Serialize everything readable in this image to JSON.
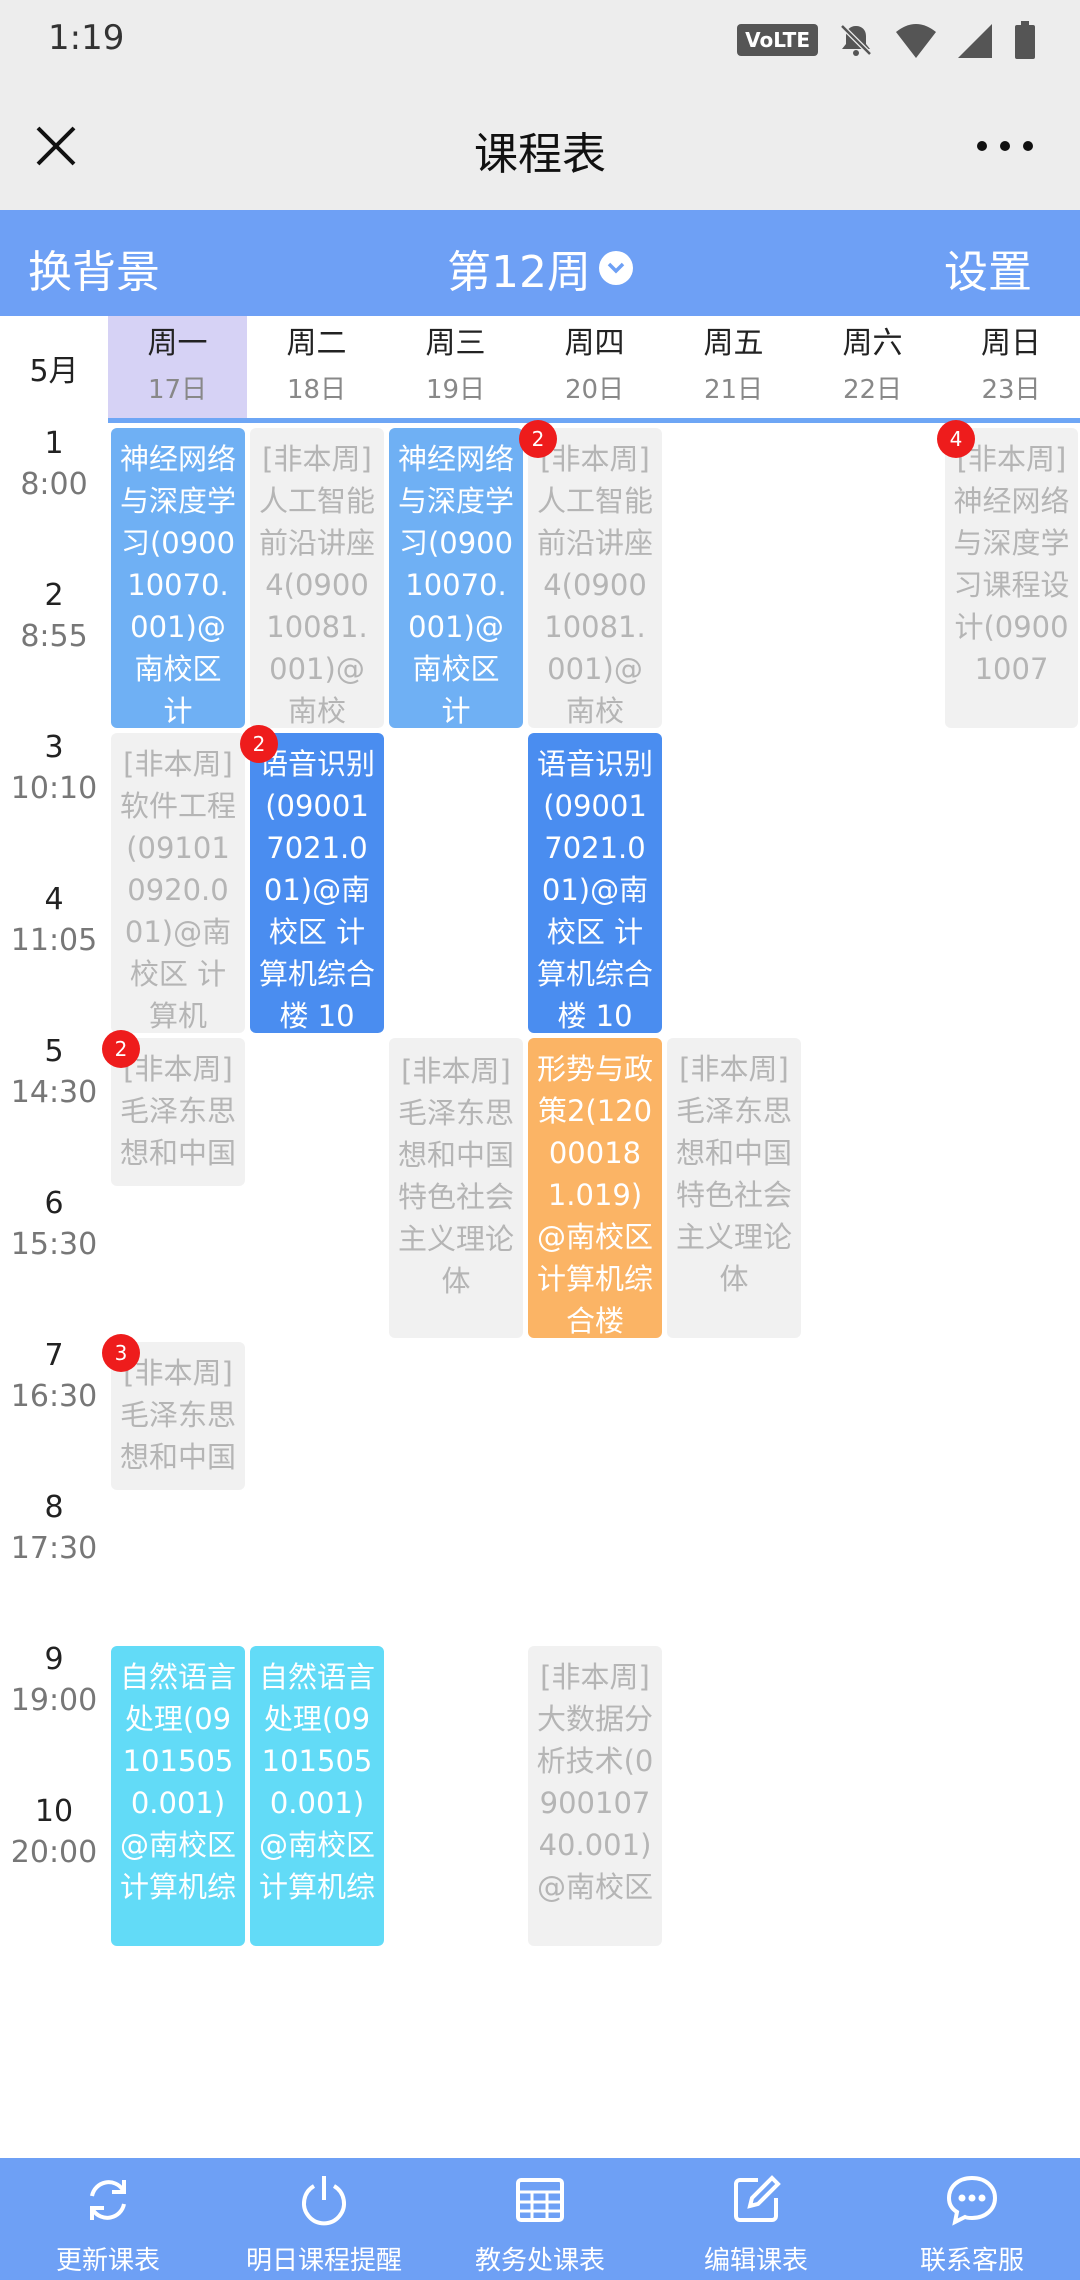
{
  "status_bar": {
    "time": "1:19",
    "network_badge": "VoLTE",
    "icons": [
      "mute-icon",
      "wifi-icon",
      "signal-icon",
      "battery-icon"
    ]
  },
  "title_bar": {
    "title": "课程表",
    "close_icon": "close-icon",
    "more_icon": "more-icon"
  },
  "toolbar": {
    "left_label": "换背景",
    "week_label": "第12周",
    "right_label": "设置",
    "accent": "#6ea0f5"
  },
  "header": {
    "month": "5月",
    "days": [
      {
        "weekday": "周一",
        "date": "17日",
        "active": true
      },
      {
        "weekday": "周二",
        "date": "18日"
      },
      {
        "weekday": "周三",
        "date": "19日"
      },
      {
        "weekday": "周四",
        "date": "20日"
      },
      {
        "weekday": "周五",
        "date": "21日"
      },
      {
        "weekday": "周六",
        "date": "22日"
      },
      {
        "weekday": "周日",
        "date": "23日"
      }
    ]
  },
  "periods": [
    {
      "num": "1",
      "time": "8:00"
    },
    {
      "num": "2",
      "time": "8:55"
    },
    {
      "num": "3",
      "time": "10:10"
    },
    {
      "num": "4",
      "time": "11:05"
    },
    {
      "num": "5",
      "time": "14:30"
    },
    {
      "num": "6",
      "time": "15:30"
    },
    {
      "num": "7",
      "time": "16:30"
    },
    {
      "num": "8",
      "time": "17:30"
    },
    {
      "num": "9",
      "time": "19:00"
    },
    {
      "num": "10",
      "time": "20:00"
    }
  ],
  "courses": [
    {
      "text": "神经网络与深度学习(090010070.001)@南校区 计",
      "style": "lblue"
    },
    {
      "text": "[非本周]人工智能前沿讲座4(090010081.001)@南校",
      "style": "gray"
    },
    {
      "text": "神经网络与深度学习(090010070.001)@南校区 计",
      "style": "lblue"
    },
    {
      "text": "[非本周]人工智能前沿讲座4(090010081.001)@南校",
      "style": "gray",
      "badge": "2"
    },
    {
      "text": "[非本周]神经网络与深度学习课程设计(09001007",
      "style": "gray",
      "badge": "4"
    },
    {
      "text": "[非本周]软件工程(091010920.001)@南校区 计算机",
      "style": "gray"
    },
    {
      "text": "语音识别(090017021.001)@南校区 计算机综合楼 10",
      "style": "dblue",
      "badge": "2"
    },
    {
      "text": "语音识别(090017021.001)@南校区 计算机综合楼 10",
      "style": "dblue"
    },
    {
      "text": "[非本周]毛泽东思想和中国",
      "style": "gray",
      "badge": "2"
    },
    {
      "text": "[非本周]毛泽东思想和中国特色社会主义理论体",
      "style": "gray"
    },
    {
      "text": "形势与政策2(120000181.019)@南校区 计算机综合楼",
      "style": "orange"
    },
    {
      "text": "[非本周]毛泽东思想和中国特色社会主义理论体",
      "style": "gray"
    },
    {
      "text": "[非本周]毛泽东思想和中国",
      "style": "gray",
      "badge": "3"
    },
    {
      "text": "自然语言处理(091015050.001)@南校区 计算机综",
      "style": "cyan"
    },
    {
      "text": "自然语言处理(091015050.001)@南校区 计算机综",
      "style": "cyan"
    },
    {
      "text": "[非本周]大数据分析技术(090010740.001)@南校区",
      "style": "gray"
    }
  ],
  "bottom_nav": [
    {
      "label": "更新课表",
      "icon": "refresh-icon"
    },
    {
      "label": "明日课程提醒",
      "icon": "power-icon"
    },
    {
      "label": "教务处课表",
      "icon": "grid-table-icon"
    },
    {
      "label": "编辑课表",
      "icon": "edit-icon"
    },
    {
      "label": "联系客服",
      "icon": "chat-icon"
    }
  ]
}
